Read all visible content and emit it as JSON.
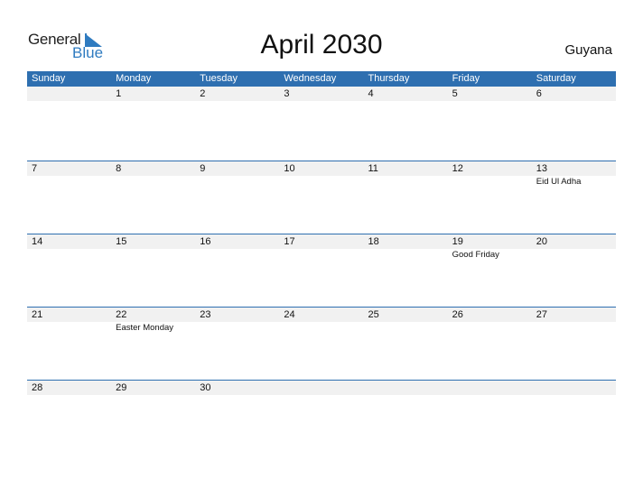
{
  "brand": {
    "general": "General",
    "blue": "Blue"
  },
  "title": "April 2030",
  "country": "Guyana",
  "days": [
    "Sunday",
    "Monday",
    "Tuesday",
    "Wednesday",
    "Thursday",
    "Friday",
    "Saturday"
  ],
  "weeks": [
    {
      "dates": [
        "",
        "1",
        "2",
        "3",
        "4",
        "5",
        "6"
      ],
      "events": [
        "",
        "",
        "",
        "",
        "",
        "",
        ""
      ]
    },
    {
      "dates": [
        "7",
        "8",
        "9",
        "10",
        "11",
        "12",
        "13"
      ],
      "events": [
        "",
        "",
        "",
        "",
        "",
        "",
        "Eid Ul Adha"
      ]
    },
    {
      "dates": [
        "14",
        "15",
        "16",
        "17",
        "18",
        "19",
        "20"
      ],
      "events": [
        "",
        "",
        "",
        "",
        "",
        "Good Friday",
        ""
      ]
    },
    {
      "dates": [
        "21",
        "22",
        "23",
        "24",
        "25",
        "26",
        "27"
      ],
      "events": [
        "",
        "Easter Monday",
        "",
        "",
        "",
        "",
        ""
      ]
    },
    {
      "dates": [
        "28",
        "29",
        "30",
        "",
        "",
        "",
        ""
      ],
      "events": [
        "",
        "",
        "",
        "",
        "",
        "",
        ""
      ]
    }
  ],
  "colors": {
    "accent": "#2e6fb0",
    "strip": "#f1f1f1",
    "logo_blue": "#2f7bc0"
  }
}
